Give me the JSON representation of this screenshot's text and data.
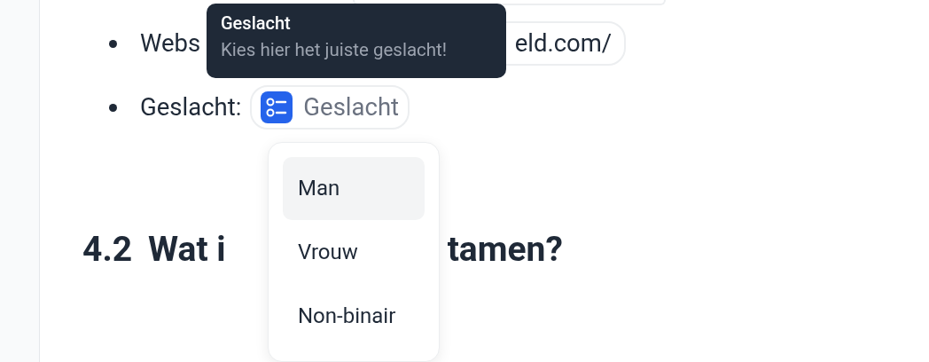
{
  "list": [
    {
      "kind": "link",
      "label": "Webs",
      "value": "eld.com/"
    },
    {
      "kind": "select",
      "label": "Geslacht:",
      "placeholder": "Geslacht"
    }
  ],
  "heading": {
    "number": "4.2",
    "parts": [
      "Wat i",
      "tamen?"
    ]
  },
  "tooltip": {
    "title": "Geslacht",
    "text": "Kies hier het juiste geslacht!"
  },
  "dropdown": {
    "options": [
      {
        "label": "Man",
        "selected": true
      },
      {
        "label": "Vrouw",
        "selected": false
      },
      {
        "label": "Non-binair",
        "selected": false
      }
    ]
  }
}
